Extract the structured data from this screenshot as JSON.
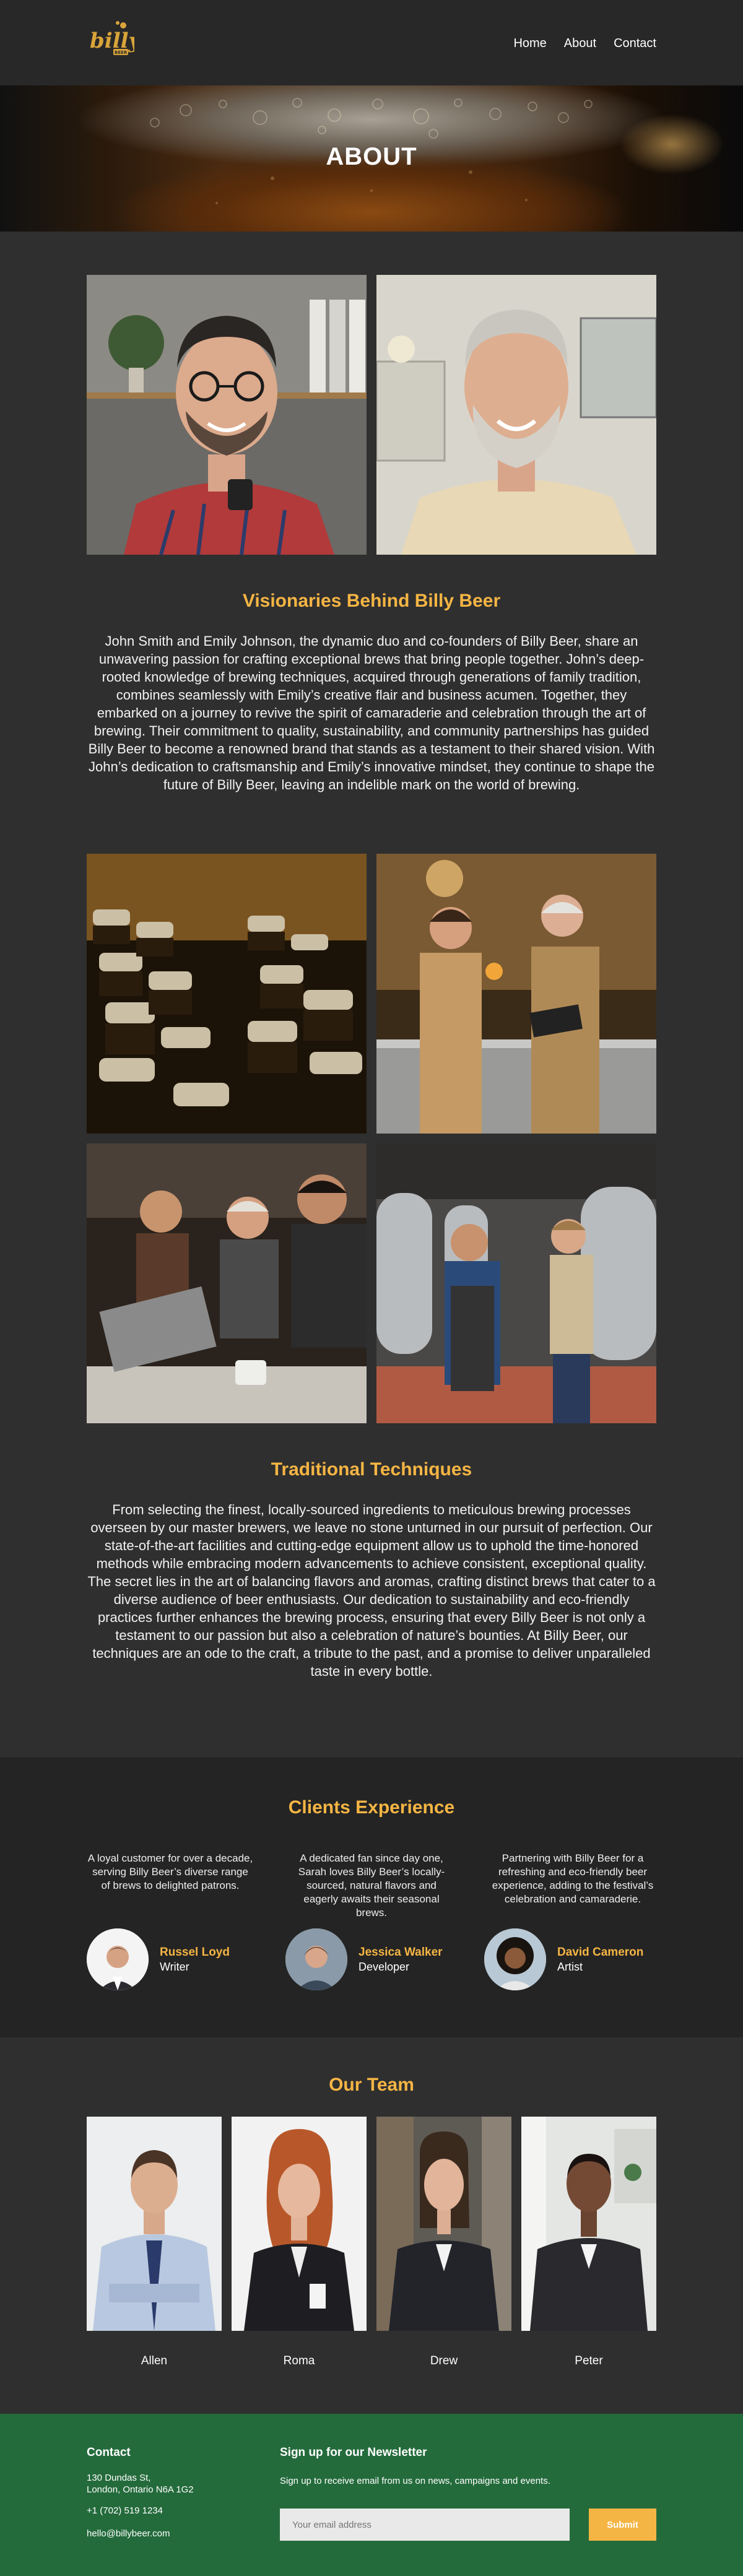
{
  "header": {
    "logo_text": "billy",
    "logo_sub": "BEER",
    "nav": [
      "Home",
      "About",
      "Contact"
    ]
  },
  "hero": {
    "title": "ABOUT"
  },
  "visionaries": {
    "title": "Visionaries Behind Billy Beer",
    "body": "John Smith and Emily Johnson, the dynamic duo and co-founders of Billy Beer, share an unwavering passion for crafting exceptional brews that bring people together. John’s deep-rooted knowledge of brewing techniques, acquired through generations of family tradition, combines seamlessly with Emily’s creative flair and business acumen. Together, they embarked on a journey to revive the spirit of camaraderie and celebration through the art of brewing. Their commitment to quality, sustainability, and community partnerships has guided Billy Beer to become a renowned brand that stands as a testament to their shared vision. With John’s dedication to craftsmanship and Emily’s innovative mindset, they continue to shape the future of Billy Beer, leaving an indelible mark on the world of brewing."
  },
  "techniques": {
    "title": "Traditional Techniques",
    "body": "From selecting the finest, locally-sourced ingredients to meticulous brewing processes overseen by our master brewers, we leave no stone unturned in our pursuit of perfection. Our state-of-the-art facilities and cutting-edge equipment allow us to uphold the time-honored methods while embracing modern advancements to achieve consistent, exceptional quality. The secret lies in the art of balancing flavors and aromas, crafting distinct brews that cater to a diverse audience of beer enthusiasts. Our dedication to sustainability and eco-friendly practices further enhances the brewing process, ensuring that every Billy Beer is not only a testament to our passion but also a celebration of nature’s bounties. At Billy Beer, our techniques are an ode to the craft, a tribute to the past, and a promise to deliver unparalleled taste in every bottle."
  },
  "clients": {
    "title": "Clients Experience",
    "items": [
      {
        "quote": "A loyal customer for over a decade, serving Billy Beer’s diverse range of brews to delighted patrons.",
        "name": "Russel Loyd",
        "role": "Writer"
      },
      {
        "quote": "A dedicated fan since day one, Sarah loves Billy Beer’s locally-sourced, natural flavors and eagerly awaits their seasonal brews.",
        "name": "Jessica Walker",
        "role": "Developer"
      },
      {
        "quote": "Partnering with Billy Beer for a refreshing and eco-friendly beer experience, adding to the festival’s celebration and camaraderie.",
        "name": "David Cameron",
        "role": "Artist"
      }
    ]
  },
  "team": {
    "title": "Our Team",
    "members": [
      "Allen",
      "Roma",
      "Drew",
      "Peter"
    ]
  },
  "footer": {
    "contact_title": "Contact",
    "address_line1": "130 Dundas St,",
    "address_line2": "London, Ontario N6A 1G2",
    "phone": "+1 (702) 519 1234",
    "email": "hello@billybeer.com",
    "newsletter_title": "Sign up for our Newsletter",
    "newsletter_text": "Sign up to receive email from us on news, campaigns and events.",
    "email_placeholder": "Your email address",
    "submit_label": "Submit"
  },
  "colors": {
    "accent": "#f5b544",
    "footer_bg": "#246b3c",
    "page_bg": "#2f2f2f"
  }
}
